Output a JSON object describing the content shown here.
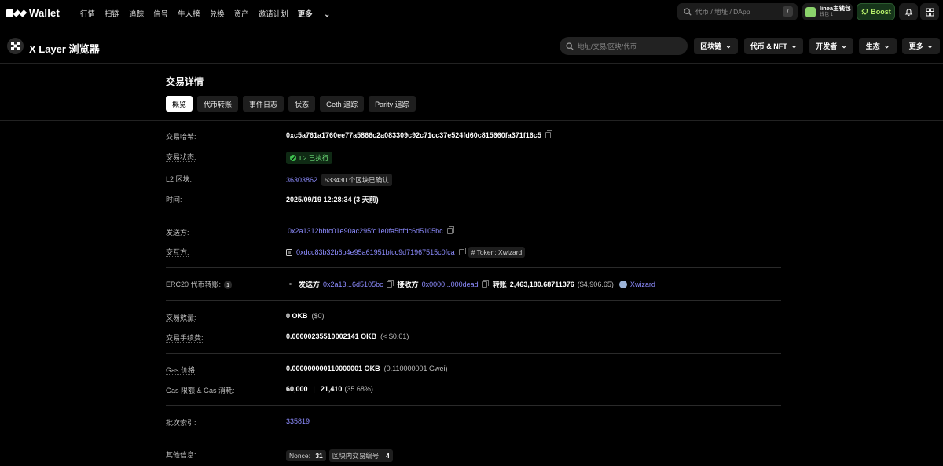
{
  "topnav": {
    "brand": "Wallet",
    "links": [
      "行情",
      "扫链",
      "追踪",
      "信号",
      "牛人榜",
      "兑换",
      "资产",
      "邀请计划"
    ],
    "more": "更多",
    "search_placeholder": "代币 / 地址 / DApp",
    "search_shortcut": "/",
    "wallet_name": "linea主钱包",
    "wallet_sub": "钱包 1",
    "boost_label": "Boost"
  },
  "subhead": {
    "title": "X Layer 浏览器",
    "search_placeholder": "地址/交易/区块/代币",
    "menus": [
      "区块链",
      "代币 & NFT",
      "开发者",
      "生态",
      "更多"
    ]
  },
  "page": {
    "title": "交易详情",
    "tabs": [
      "概览",
      "代币转账",
      "事件日志",
      "状态",
      "Geth 追踪",
      "Parity 追踪"
    ]
  },
  "details": {
    "tx_hash_label": "交易哈希:",
    "tx_hash": "0xc5a761a1760ee77a5866c2a083309c92c71cc37e524fd60c815660fa371f16c5",
    "status_label": "交易状态:",
    "status": "L2 已执行",
    "block_label": "L2 区块:",
    "block_number": "36303862",
    "block_confirmations": "533430 个区块已确认",
    "time_label": "时间:",
    "time": "2025/09/19 12:28:34 (3 天前)",
    "from_label": "发送方:",
    "from": "0x2a1312bbfc01e90ac295fd1e0fa5bfdc6d5105bc",
    "to_label": "交互方:",
    "to": "0xdcc83b32b6b4e95a61951bfcc9d71967515c0fca",
    "to_tag": "# Token: Xwizard",
    "erc20_label": "ERC20 代币转账:",
    "erc20_count": "1",
    "erc20_from_label": "发送方",
    "erc20_from": "0x2a13...6d5105bc",
    "erc20_to_label": "接收方",
    "erc20_to": "0x0000...000dead",
    "erc20_amount_label": "转账",
    "erc20_amount": "2,463,180.68711376",
    "erc20_amount_usd": "($4,906.65)",
    "erc20_token": "Xwizard",
    "value_label": "交易数量:",
    "value": "0 OKB",
    "value_usd": "($0)",
    "fee_label": "交易手续费:",
    "fee": "0.00000235510002141 OKB",
    "fee_usd": "(< $0.01)",
    "gas_price_label": "Gas 价格:",
    "gas_price": "0.000000000110000001 OKB",
    "gas_price_gwei": "(0.110000001 Gwei)",
    "gas_limit_label": "Gas 限额 & Gas 消耗:",
    "gas_limit": "60,000",
    "gas_sep": "|",
    "gas_used": "21,410",
    "gas_used_pct": "(35.68%)",
    "batch_label": "批次索引:",
    "batch": "335819",
    "other_label": "其他信息:",
    "nonce_label": "Nonce:",
    "nonce": "31",
    "position_label": "区块内交易编号:",
    "position": "4"
  }
}
